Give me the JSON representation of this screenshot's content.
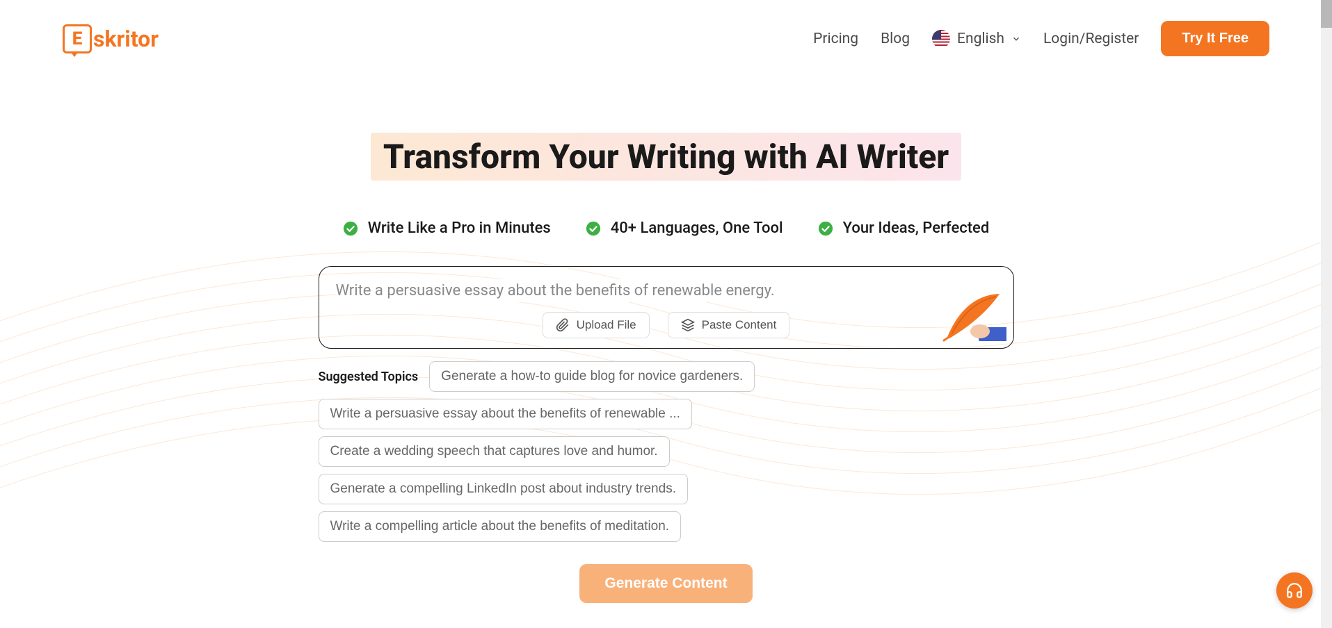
{
  "header": {
    "logo_text": "skritor",
    "logo_e": "E",
    "nav": {
      "pricing": "Pricing",
      "blog": "Blog",
      "language": "English",
      "login": "Login/Register",
      "try_free": "Try It Free"
    }
  },
  "hero": {
    "title": "Transform Your Writing with AI Writer",
    "features": [
      "Write Like a Pro in Minutes",
      "40+ Languages, One Tool",
      "Your Ideas, Perfected"
    ],
    "input_placeholder": "Write a persuasive essay about the benefits of renewable energy.",
    "upload_file": "Upload File",
    "paste_content": "Paste Content",
    "suggested_label": "Suggested Topics",
    "suggested_topics": [
      "Generate a how-to guide blog for novice gardeners.",
      "Write a persuasive essay about the benefits of renewable ...",
      "Create a wedding speech that captures love and humor.",
      "Generate a compelling LinkedIn post about industry trends.",
      "Write a compelling article about the benefits of meditation."
    ],
    "generate_button": "Generate Content"
  }
}
